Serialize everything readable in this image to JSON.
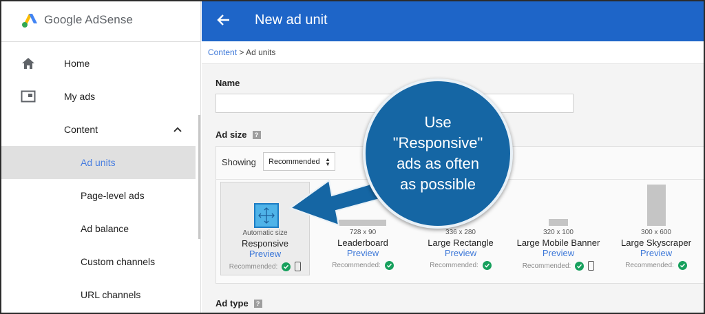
{
  "app": {
    "logo_text": "Google AdSense"
  },
  "header": {
    "title": "New ad unit"
  },
  "breadcrumb": {
    "link": "Content",
    "separator": ">",
    "current": "Ad units"
  },
  "sidebar": {
    "items": [
      {
        "label": "Home",
        "icon": "home-icon"
      },
      {
        "label": "My ads",
        "icon": "my-ads-icon"
      },
      {
        "label": "Content",
        "icon": "chevron-up-icon"
      },
      {
        "label": "Ad units"
      },
      {
        "label": "Page-level ads"
      },
      {
        "label": "Ad balance"
      },
      {
        "label": "Custom channels"
      },
      {
        "label": "URL channels"
      }
    ],
    "active": "Ad units"
  },
  "form": {
    "name_label": "Name",
    "name_value": "",
    "ad_size_label": "Ad size",
    "help_glyph": "?",
    "showing_label": "Showing",
    "showing_value": "Recommended",
    "ad_type_label": "Ad type"
  },
  "ad_sizes": [
    {
      "dim": "Automatic size",
      "name": "Responsive",
      "preview": "Preview",
      "rec": "Recommended:",
      "mobile": true
    },
    {
      "dim": "728 x 90",
      "name": "Leaderboard",
      "preview": "Preview",
      "rec": "Recommended:",
      "mobile": false
    },
    {
      "dim": "336 x 280",
      "name": "Large Rectangle",
      "preview": "Preview",
      "rec": "Recommended:",
      "mobile": false
    },
    {
      "dim": "320 x 100",
      "name": "Large Mobile Banner",
      "preview": "Preview",
      "rec": "Recommended:",
      "mobile": true
    },
    {
      "dim": "300 x 600",
      "name": "Large Skyscraper",
      "preview": "Preview",
      "rec": "Recommended:",
      "mobile": false
    }
  ],
  "callout": {
    "text": "Use\n\"Responsive\"\nads as often\nas possible"
  },
  "colors": {
    "header": "#1e65c8",
    "accent": "#3d78d8",
    "callout": "#1566a4",
    "check": "#17a05d"
  }
}
